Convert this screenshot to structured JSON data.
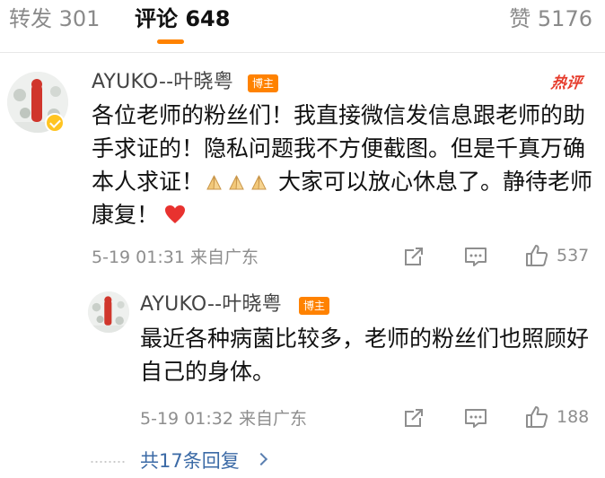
{
  "tabs": {
    "repost": "转发 301",
    "comment": "评论 648",
    "like": "赞 5176"
  },
  "colors": {
    "accent": "#ff8200",
    "hot": "#e63c2c",
    "link": "#3b6aa6",
    "muted": "#8e8e8e",
    "heart": "#e8322f"
  },
  "comment": {
    "username": "AYUKO--叶晓粤",
    "badge": "博主",
    "hot_tag": "热评",
    "text_part1": "各位老师的粉丝们！我直接微信发信息跟老师的助手求证的！隐私问题我不方便截图。但是千真万确本人求证！",
    "text_part2": " 大家可以放心休息了。静待老师康复！",
    "time": "5-19 01:31 来自广东",
    "likes": "537",
    "icons": [
      "share-icon",
      "comment-icon",
      "like-icon",
      "pray-emoji",
      "heart-emoji",
      "verified-icon"
    ]
  },
  "reply": {
    "username": "AYUKO--叶晓粤",
    "badge": "博主",
    "text": "最近各种病菌比较多，老师的粉丝们也照顾好自己的身体。",
    "time": "5-19 01:32 来自广东",
    "likes": "188"
  },
  "replies_link": "共17条回复"
}
